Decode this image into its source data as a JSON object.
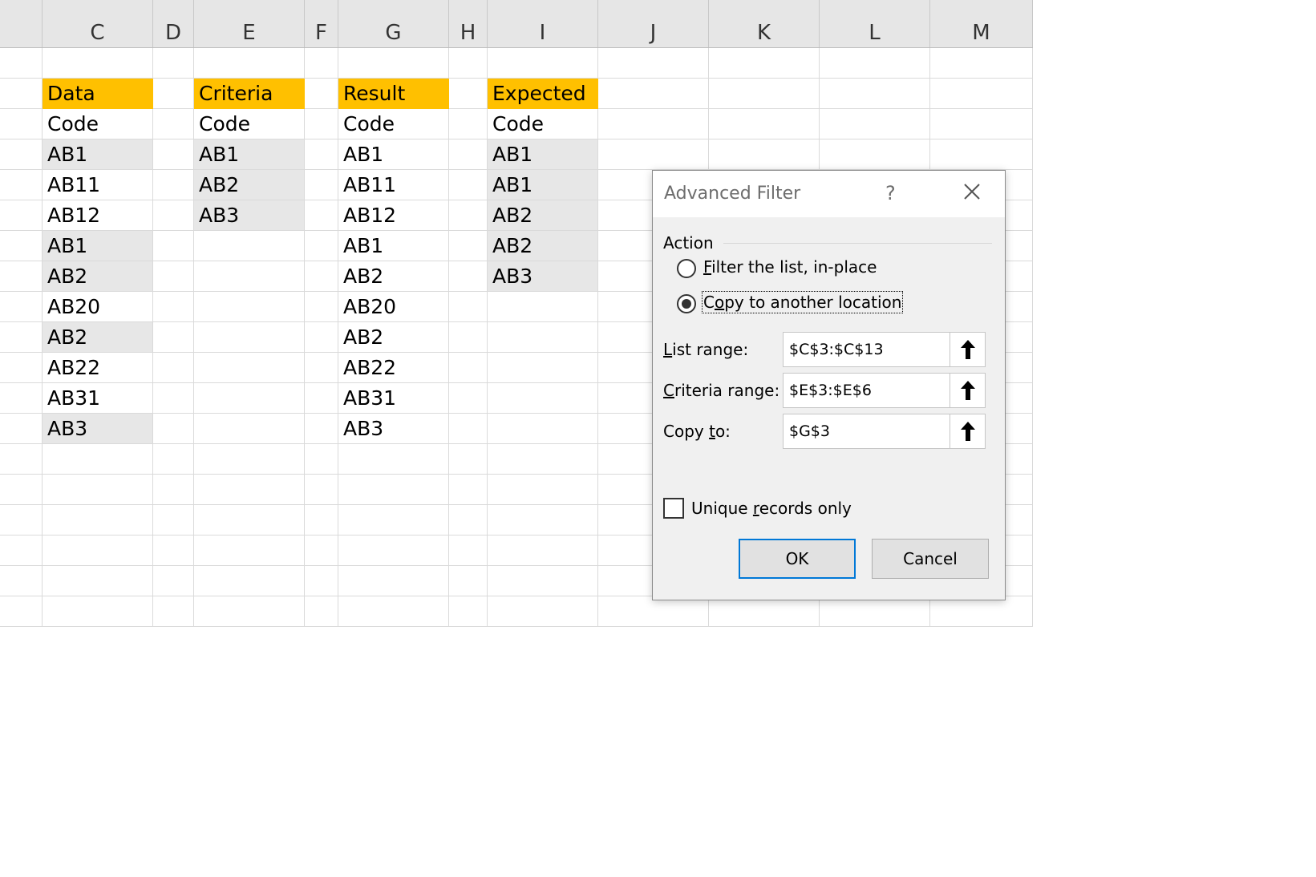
{
  "sheet": {
    "columns": [
      "C",
      "D",
      "E",
      "F",
      "G",
      "H",
      "I",
      "J",
      "K",
      "L",
      "M"
    ],
    "rows": [
      [
        "",
        "",
        "",
        "",
        "",
        "",
        "",
        "",
        "",
        "",
        ""
      ],
      [
        "Data",
        "",
        "Criteria",
        "",
        "Result",
        "",
        "Expected",
        "",
        "",
        "",
        ""
      ],
      [
        "Code",
        "",
        "Code",
        "",
        "Code",
        "",
        "Code",
        "",
        "",
        "",
        ""
      ],
      [
        "AB1",
        "",
        "AB1",
        "",
        "AB1",
        "",
        "AB1",
        "",
        "",
        "",
        ""
      ],
      [
        "AB11",
        "",
        "AB2",
        "",
        "AB11",
        "",
        "AB1",
        "",
        "",
        "",
        ""
      ],
      [
        "AB12",
        "",
        "AB3",
        "",
        "AB12",
        "",
        "AB2",
        "",
        "",
        "",
        ""
      ],
      [
        "AB1",
        "",
        "",
        "",
        "AB1",
        "",
        "AB2",
        "",
        "",
        "",
        ""
      ],
      [
        "AB2",
        "",
        "",
        "",
        "AB2",
        "",
        "AB3",
        "",
        "",
        "",
        ""
      ],
      [
        "AB20",
        "",
        "",
        "",
        "AB20",
        "",
        "",
        "",
        "",
        "",
        ""
      ],
      [
        "AB2",
        "",
        "",
        "",
        "AB2",
        "",
        "",
        "",
        "",
        "",
        ""
      ],
      [
        "AB22",
        "",
        "",
        "",
        "AB22",
        "",
        "",
        "",
        "",
        "",
        ""
      ],
      [
        "AB31",
        "",
        "",
        "",
        "AB31",
        "",
        "",
        "",
        "",
        "",
        ""
      ],
      [
        "AB3",
        "",
        "",
        "",
        "AB3",
        "",
        "",
        "",
        "",
        "",
        ""
      ],
      [
        "",
        "",
        "",
        "",
        "",
        "",
        "",
        "",
        "",
        "",
        ""
      ],
      [
        "",
        "",
        "",
        "",
        "",
        "",
        "",
        "",
        "",
        "",
        ""
      ],
      [
        "",
        "",
        "",
        "",
        "",
        "",
        "",
        "",
        "",
        "",
        ""
      ],
      [
        "",
        "",
        "",
        "",
        "",
        "",
        "",
        "",
        "",
        "",
        ""
      ],
      [
        "",
        "",
        "",
        "",
        "",
        "",
        "",
        "",
        "",
        "",
        ""
      ],
      [
        "",
        "",
        "",
        "",
        "",
        "",
        "",
        "",
        "",
        "",
        ""
      ]
    ],
    "header_fill": "#ffc000",
    "highlight_fill": "#e7e7e7"
  },
  "dialog": {
    "title": "Advanced Filter",
    "help": "?",
    "action_label": "Action",
    "radio_filter": {
      "pre": "",
      "key": "F",
      "post": "ilter the list, in-place"
    },
    "radio_copy": {
      "pre": "C",
      "key": "o",
      "post": "py to another location"
    },
    "selected": "copy",
    "list_range": {
      "key": "L",
      "post": "ist range:",
      "value": "$C$3:$C$13"
    },
    "criteria_range": {
      "key": "C",
      "post": "riteria range:",
      "value": "$E$3:$E$6"
    },
    "copy_to": {
      "pre": "Copy ",
      "key": "t",
      "post": "o:",
      "value": "$G$3"
    },
    "unique": {
      "pre": "Unique ",
      "key": "r",
      "post": "ecords only",
      "checked": false
    },
    "ok_label": "OK",
    "cancel_label": "Cancel",
    "accent_color": "#0078d7"
  }
}
